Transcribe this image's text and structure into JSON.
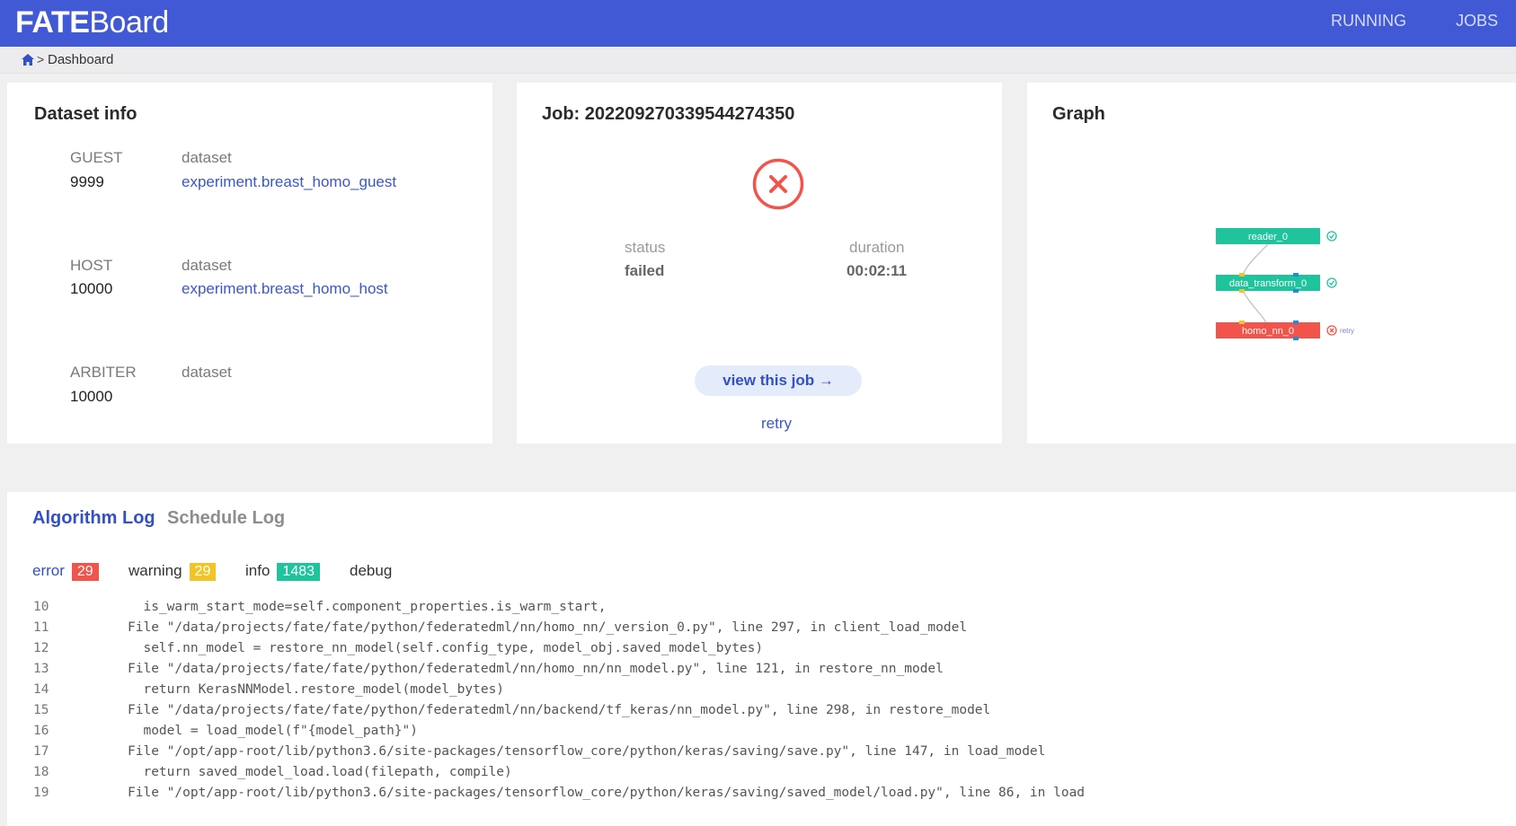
{
  "header": {
    "brand_bold": "FATE",
    "brand_rest": "Board",
    "nav": {
      "running": "RUNNING",
      "jobs": "JOBS"
    }
  },
  "breadcrumb": {
    "separator": ">",
    "current": "Dashboard"
  },
  "dataset_info": {
    "title": "Dataset info",
    "rows": [
      {
        "role": "GUEST",
        "party_id": "9999",
        "label": "dataset",
        "value": "experiment.breast_homo_guest"
      },
      {
        "role": "HOST",
        "party_id": "10000",
        "label": "dataset",
        "value": "experiment.breast_homo_host"
      },
      {
        "role": "ARBITER",
        "party_id": "10000",
        "label": "dataset",
        "value": ""
      }
    ]
  },
  "job": {
    "title": "Job: 202209270339544274350",
    "status_label": "status",
    "status_value": "failed",
    "duration_label": "duration",
    "duration_value": "00:02:11",
    "view_button": "view this job →",
    "retry": "retry",
    "status_color": "#f2534a"
  },
  "graph": {
    "title": "Graph",
    "nodes": [
      {
        "name": "reader_0",
        "state": "success",
        "color": "#1fc49c"
      },
      {
        "name": "data_transform_0",
        "state": "success",
        "color": "#1fc49c"
      },
      {
        "name": "homo_nn_0",
        "state": "failed",
        "color": "#f2534a",
        "action": "retry"
      }
    ]
  },
  "logs": {
    "tabs": {
      "algorithm": "Algorithm Log",
      "schedule": "Schedule Log"
    },
    "filters": {
      "error": {
        "label": "error",
        "count": "29"
      },
      "warning": {
        "label": "warning",
        "count": "29"
      },
      "info": {
        "label": "info",
        "count": "1483"
      },
      "debug": {
        "label": "debug"
      }
    },
    "lines": [
      {
        "n": "10",
        "text": "  is_warm_start_mode=self.component_properties.is_warm_start,"
      },
      {
        "n": "11",
        "text": "File \"/data/projects/fate/fate/python/federatedml/nn/homo_nn/_version_0.py\", line 297, in client_load_model"
      },
      {
        "n": "12",
        "text": "  self.nn_model = restore_nn_model(self.config_type, model_obj.saved_model_bytes)"
      },
      {
        "n": "13",
        "text": "File \"/data/projects/fate/fate/python/federatedml/nn/homo_nn/nn_model.py\", line 121, in restore_nn_model"
      },
      {
        "n": "14",
        "text": "  return KerasNNModel.restore_model(model_bytes)"
      },
      {
        "n": "15",
        "text": "File \"/data/projects/fate/fate/python/federatedml/nn/backend/tf_keras/nn_model.py\", line 298, in restore_model"
      },
      {
        "n": "16",
        "text": "  model = load_model(f\"{model_path}\")"
      },
      {
        "n": "17",
        "text": "File \"/opt/app-root/lib/python3.6/site-packages/tensorflow_core/python/keras/saving/save.py\", line 147, in load_model"
      },
      {
        "n": "18",
        "text": "  return saved_model_load.load(filepath, compile)"
      },
      {
        "n": "19",
        "text": "File \"/opt/app-root/lib/python3.6/site-packages/tensorflow_core/python/keras/saving/saved_model/load.py\", line 86, in load"
      }
    ]
  }
}
